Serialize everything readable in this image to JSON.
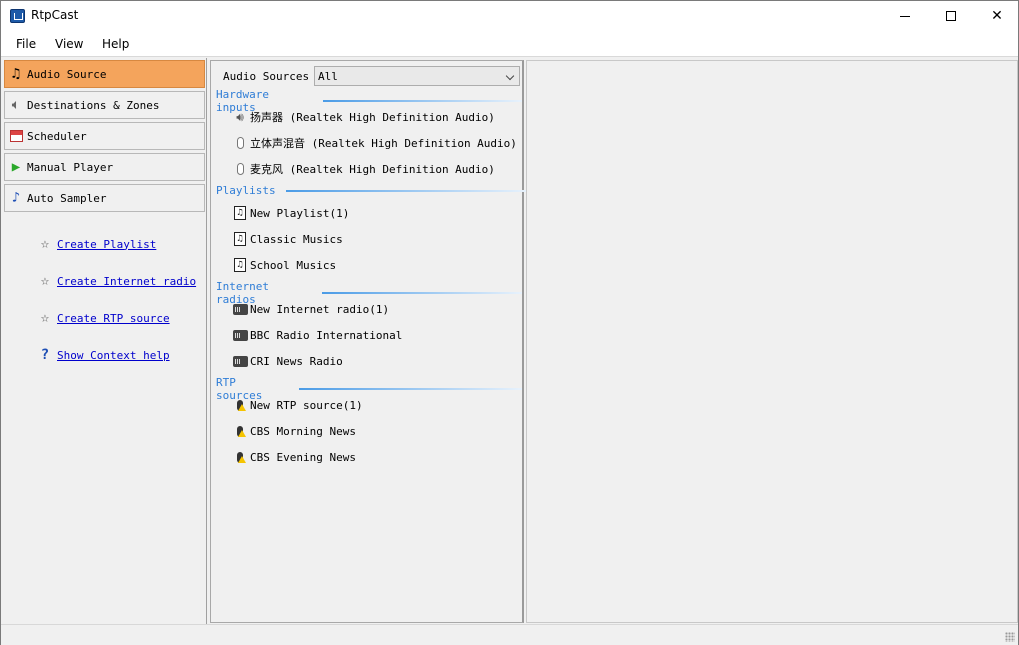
{
  "window": {
    "title": "RtpCast"
  },
  "menu": [
    "File",
    "View",
    "Help"
  ],
  "nav": [
    {
      "label": "Audio Source",
      "icon": "music-note-icon",
      "active": true
    },
    {
      "label": "Destinations & Zones",
      "icon": "speaker-icon",
      "active": false
    },
    {
      "label": "Scheduler",
      "icon": "calendar-icon",
      "active": false
    },
    {
      "label": "Manual Player",
      "icon": "play-icon",
      "active": false
    },
    {
      "label": "Auto Sampler",
      "icon": "music-note-icon",
      "active": false
    }
  ],
  "links": [
    {
      "label": "Create Playlist",
      "icon": "star-icon"
    },
    {
      "label": "Create Internet radio",
      "icon": "star-icon"
    },
    {
      "label": "Create RTP source",
      "icon": "star-icon"
    },
    {
      "label": "Show Context help",
      "icon": "help-icon"
    }
  ],
  "sources": {
    "label": "Audio Sources",
    "selected": "All",
    "groups": [
      {
        "title": "Hardware inputs",
        "items": [
          {
            "label": "扬声器 (Realtek High Definition Audio)",
            "icon": "speaker-icon"
          },
          {
            "label": "立体声混音 (Realtek High Definition Audio)",
            "icon": "microphone-icon"
          },
          {
            "label": "麦克风 (Realtek High Definition Audio)",
            "icon": "microphone-icon"
          }
        ]
      },
      {
        "title": "Playlists",
        "items": [
          {
            "label": "New Playlist(1)",
            "icon": "playlist-icon"
          },
          {
            "label": "Classic Musics",
            "icon": "playlist-icon"
          },
          {
            "label": "School Musics",
            "icon": "playlist-icon"
          }
        ]
      },
      {
        "title": "Internet radios",
        "items": [
          {
            "label": "New Internet radio(1)",
            "icon": "radio-icon"
          },
          {
            "label": "BBC Radio International",
            "icon": "radio-icon"
          },
          {
            "label": "CRI News Radio",
            "icon": "radio-icon"
          }
        ]
      },
      {
        "title": "RTP sources",
        "items": [
          {
            "label": "New RTP source(1)",
            "icon": "rtp-mic-icon"
          },
          {
            "label": "CBS Morning News",
            "icon": "rtp-mic-icon"
          },
          {
            "label": "CBS Evening News",
            "icon": "rtp-mic-icon"
          }
        ]
      }
    ]
  },
  "colors": {
    "active_nav": "#f4a45c",
    "group_title": "#2f7dd6",
    "link": "#0000cc"
  }
}
